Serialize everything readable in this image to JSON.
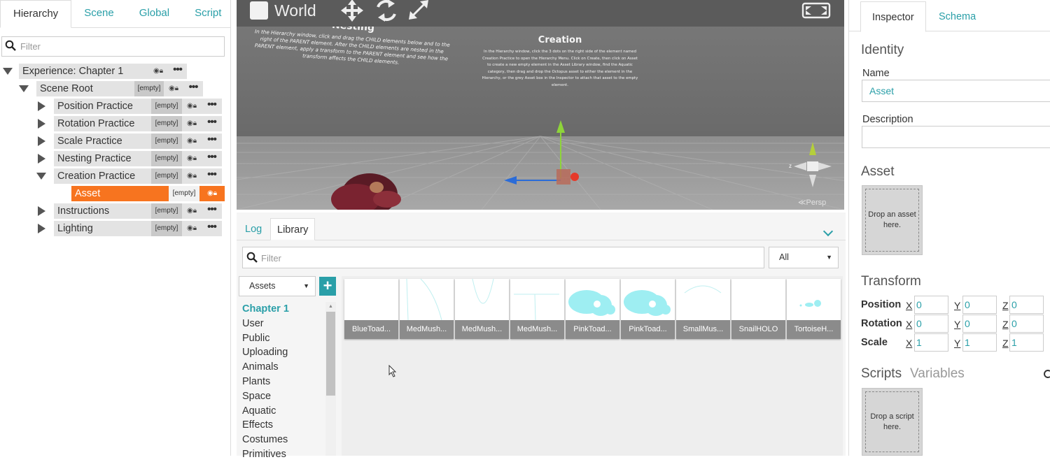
{
  "hierarchy": {
    "tabs": [
      "Hierarchy",
      "Scene",
      "Global",
      "Script"
    ],
    "filter_placeholder": "Filter",
    "empty_tag": "[empty]",
    "dots": "•••",
    "items": [
      {
        "label": "Experience: Chapter 1"
      },
      {
        "label": "Scene Root"
      },
      {
        "label": "Position Practice"
      },
      {
        "label": "Rotation Practice"
      },
      {
        "label": "Scale Practice"
      },
      {
        "label": "Nesting Practice"
      },
      {
        "label": "Creation Practice"
      },
      {
        "label": "Asset"
      },
      {
        "label": "Instructions"
      },
      {
        "label": "Lighting"
      }
    ]
  },
  "viewport": {
    "mode_label": "World",
    "nesting_title": "Nesting",
    "nesting_text": "In the Hierarchy window, click and drag the CHILD elements below and to the right of the PARENT element. After the CHILD elements are nested in the PARENT element, apply a transform to the PARENT element and see how the transform affects the CHILD elements.",
    "creation_title": "Creation",
    "creation_text": "In the Hierarchy window, click the 3 dots on the right side of the element named Creation Practice to open the Hierarchy Menu. Click on Create, then click on Asset to create a new empty element in the Asset Library window, find the Aquatic category, then drag and drop the Octopus asset to either the element in the Hierarchy, or the grey Asset box in the Inspector to attach that asset to the empty element.",
    "persp_label": "≪Persp",
    "axis_z": "z"
  },
  "library": {
    "tabs": [
      "Log",
      "Library"
    ],
    "filter_placeholder": "Filter",
    "scope_select": "All",
    "type_select": "Assets",
    "plus": "+",
    "categories": [
      "Chapter 1",
      "User",
      "Public",
      "Uploading",
      "Animals",
      "Plants",
      "Space",
      "Aquatic",
      "Effects",
      "Costumes",
      "Primitives"
    ],
    "assets": [
      "BlueToad...",
      "MedMush...",
      "MedMush...",
      "MedMush...",
      "PinkToad...",
      "PinkToad...",
      "SmallMus...",
      "SnailHOLO",
      "TortoiseH..."
    ]
  },
  "inspector": {
    "tabs": [
      "Inspector",
      "Schema"
    ],
    "identity_heading": "Identity",
    "name_label": "Name",
    "name_value": "Asset",
    "description_label": "Description",
    "description_value": "",
    "asset_heading": "Asset",
    "asset_drop": "Drop an asset here.",
    "transform_heading": "Transform",
    "position_label": "Position",
    "rotation_label": "Rotation",
    "scale_label": "Scale",
    "axes": [
      "X",
      "Y",
      "Z"
    ],
    "position": [
      "0",
      "0",
      "0"
    ],
    "rotation": [
      "0",
      "0",
      "0"
    ],
    "scale": [
      "1",
      "1",
      "1"
    ],
    "scripts_tab": "Scripts",
    "variables_tab": "Variables",
    "script_drop": "Drop a script here."
  },
  "colors": {
    "accent": "#2a9fa8",
    "selection": "#f7741f",
    "viewport_bg": "#6c6c6c"
  }
}
